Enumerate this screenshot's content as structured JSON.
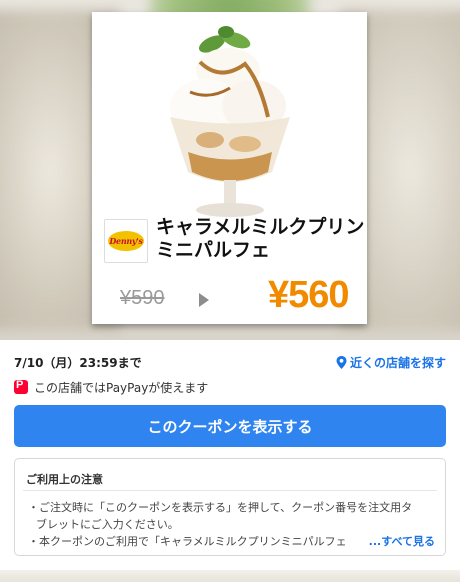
{
  "coupon": {
    "brand_logo_text": "Denny's",
    "product_name_line1": "キャラメルミルクプリン",
    "product_name_line2": "ミニパルフェ",
    "old_price": "¥590",
    "new_price": "¥560",
    "accent_color": "#f28a00"
  },
  "meta": {
    "deadline": "7/10（月）23:59まで",
    "nearby_link": "近くの店舗を探す",
    "paypay_badge": "P",
    "paypay_text": "この店舗ではPayPayが使えます"
  },
  "actions": {
    "show_coupon_label": "このクーポンを表示する",
    "button_color": "#2f84f0"
  },
  "notes": {
    "title": "ご利用上の注意",
    "line1": "・ご注文時に「このクーポンを表示する」を押して、クーポン番号を注文用タ",
    "line2": "ブレットにご入力ください。",
    "line3": "・本クーポンのご利用で「キャラメルミルクプリンミニパルフェ",
    "see_all": "...すべて見る"
  }
}
